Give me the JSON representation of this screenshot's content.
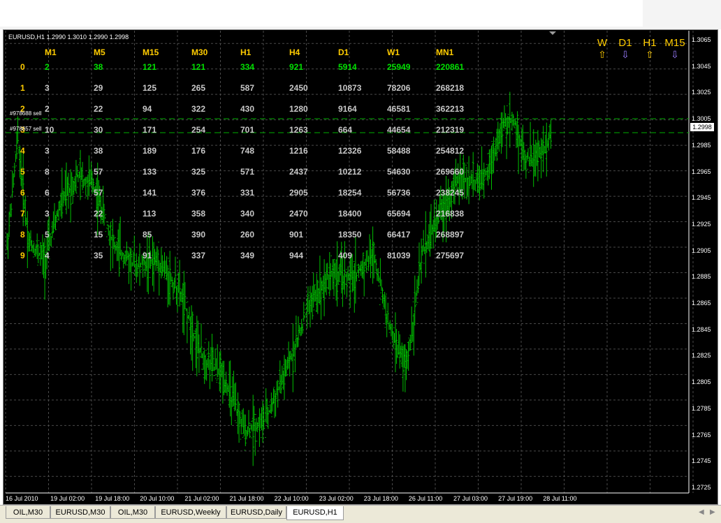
{
  "symbol_info": "EURUSD,H1  1.2990 1.3010 1.2990 1.2998",
  "columns": [
    "M1",
    "M5",
    "M15",
    "M30",
    "H1",
    "H4",
    "D1",
    "W1",
    "MN1"
  ],
  "rows": [
    {
      "label": "0",
      "values": [
        "2",
        "38",
        "121",
        "121",
        "334",
        "921",
        "5914",
        "25949",
        "220861"
      ]
    },
    {
      "label": "1",
      "values": [
        "3",
        "29",
        "125",
        "265",
        "587",
        "2450",
        "10873",
        "78206",
        "268218"
      ]
    },
    {
      "label": "2",
      "values": [
        "2",
        "22",
        "94",
        "322",
        "430",
        "1280",
        "9164",
        "46581",
        "362213"
      ]
    },
    {
      "label": "3",
      "values": [
        "10",
        "30",
        "171",
        "254",
        "701",
        "1263",
        "664",
        "44654",
        "212319"
      ]
    },
    {
      "label": "4",
      "values": [
        "3",
        "38",
        "189",
        "176",
        "748",
        "1216",
        "12326",
        "58488",
        "254812"
      ]
    },
    {
      "label": "5",
      "values": [
        "8",
        "57",
        "133",
        "325",
        "571",
        "2437",
        "10212",
        "54630",
        "269660"
      ]
    },
    {
      "label": "6",
      "values": [
        "6",
        "57",
        "141",
        "376",
        "331",
        "2905",
        "18254",
        "56736",
        "238245"
      ]
    },
    {
      "label": "7",
      "values": [
        "3",
        "22",
        "113",
        "358",
        "340",
        "2470",
        "18400",
        "65694",
        "216838"
      ]
    },
    {
      "label": "8",
      "values": [
        "5",
        "15",
        "85",
        "390",
        "260",
        "901",
        "18350",
        "66417",
        "268897"
      ]
    },
    {
      "label": "9",
      "values": [
        "4",
        "35",
        "91",
        "337",
        "349",
        "944",
        "409",
        "81039",
        "275697"
      ]
    }
  ],
  "orders": [
    {
      "label": "#978688 sell"
    },
    {
      "label": "#978657 sell"
    }
  ],
  "signals": [
    {
      "label": "W",
      "dir": "up"
    },
    {
      "label": "D1",
      "dir": "down"
    },
    {
      "label": "H1",
      "dir": "up"
    },
    {
      "label": "M15",
      "dir": "down"
    }
  ],
  "current_price": "1.2998",
  "price_scale": [
    "1.3065",
    "1.3045",
    "1.3025",
    "1.3005",
    "1.2985",
    "1.2965",
    "1.2945",
    "1.2925",
    "1.2905",
    "1.2885",
    "1.2865",
    "1.2845",
    "1.2825",
    "1.2805",
    "1.2785",
    "1.2765",
    "1.2745",
    "1.2725"
  ],
  "time_scale": [
    "16 Jul 2010",
    "19 Jul 02:00",
    "19 Jul 18:00",
    "20 Jul 10:00",
    "21 Jul 02:00",
    "21 Jul 18:00",
    "22 Jul 10:00",
    "23 Jul 02:00",
    "23 Jul 18:00",
    "26 Jul 11:00",
    "27 Jul 03:00",
    "27 Jul 19:00",
    "28 Jul 11:00"
  ],
  "tabs": [
    "OIL,M30",
    "EURUSD,M30",
    "OIL,M30",
    "EURUSD,Weekly",
    "EURUSD,Daily",
    "EURUSD,H1"
  ],
  "active_tab": "EURUSD,H1",
  "colors": {
    "background": "#000000",
    "bars": "#00c000",
    "grid": "#4a4a4a",
    "header": "#ffcc00",
    "highlight": "#00e000",
    "up_arrow": "#ffcc00",
    "down_arrow": "#9a7cff"
  }
}
